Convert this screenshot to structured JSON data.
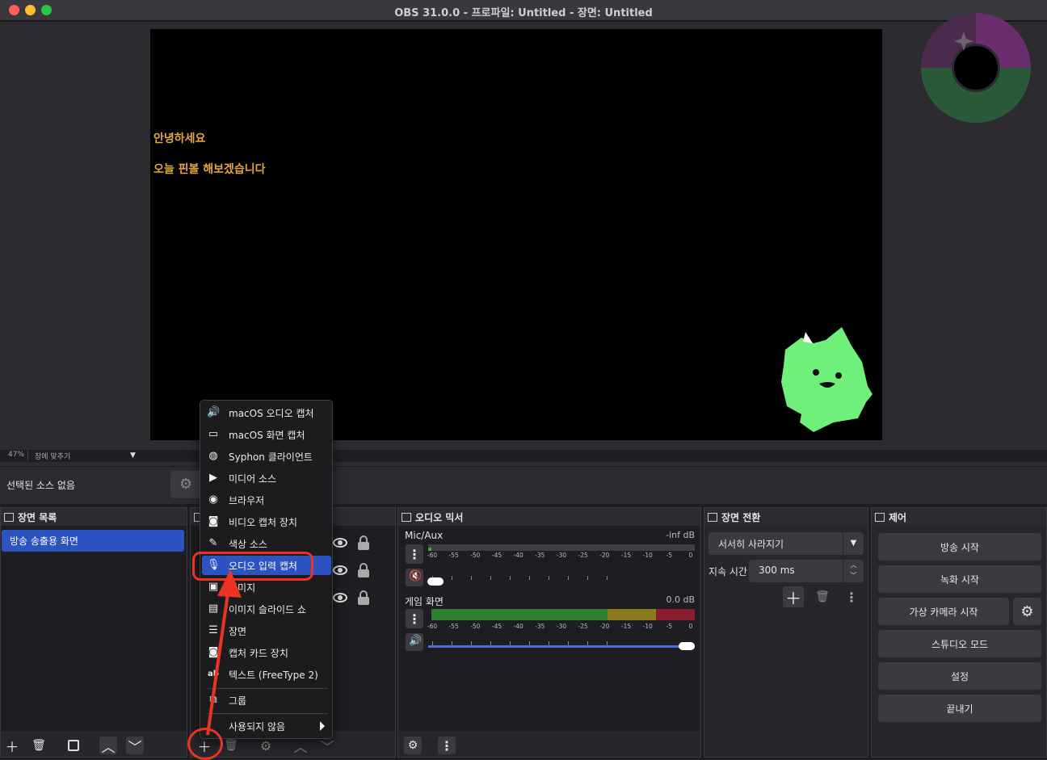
{
  "window": {
    "title": "OBS 31.0.0 - 프로파일: Untitled - 장면: Untitled"
  },
  "preview": {
    "line1": "안녕하세요",
    "line2": "오늘 핀볼 해보겠습니다",
    "zoom": "47%",
    "fit_label": "창에 맞추기"
  },
  "source_bar": {
    "no_source": "선택된 소스 없음"
  },
  "scenes": {
    "title": "장면 목록",
    "items": [
      "방송 송출용 화면"
    ]
  },
  "context_menu": {
    "items": [
      {
        "label": "macOS 오디오 캡처",
        "icon": "speaker-icon"
      },
      {
        "label": "macOS 화면 캡처",
        "icon": "monitor-icon"
      },
      {
        "label": "Syphon 클라이언트",
        "icon": "gamepad-icon"
      },
      {
        "label": "미디어 소스",
        "icon": "play-icon"
      },
      {
        "label": "브라우저",
        "icon": "globe-icon"
      },
      {
        "label": "비디오 캡처 장치",
        "icon": "camera-icon"
      },
      {
        "label": "색상 소스",
        "icon": "brush-icon"
      },
      {
        "label": "오디오 입력 캡처",
        "icon": "microphone-icon"
      },
      {
        "label": "이미지",
        "icon": "image-icon"
      },
      {
        "label": "이미지 슬라이드 쇼",
        "icon": "slideshow-icon"
      },
      {
        "label": "장면",
        "icon": "list-icon"
      },
      {
        "label": "캡처 카드 장치",
        "icon": "camera-icon"
      },
      {
        "label": "텍스트 (FreeType 2)",
        "icon": "text-icon"
      },
      {
        "label": "그룹",
        "icon": "group-icon"
      },
      {
        "label": "사용되지 않음",
        "icon": ""
      }
    ],
    "selected": "오디오 입력 캡처"
  },
  "mixer": {
    "title": "오디오 믹서",
    "channels": [
      {
        "name": "Mic/Aux",
        "db": "-inf dB",
        "muted": true,
        "volume": 0.0
      },
      {
        "name": "게임 화면",
        "db": "0.0 dB",
        "muted": false,
        "volume": 1.0
      }
    ],
    "scale": [
      "-60",
      "-55",
      "-50",
      "-45",
      "-40",
      "-35",
      "-30",
      "-25",
      "-20",
      "-15",
      "-10",
      "-5",
      "0"
    ]
  },
  "transitions": {
    "title": "장면 전환",
    "type": "서서히 사라지기",
    "duration_label": "지속 시간",
    "duration": "300 ms"
  },
  "controls": {
    "title": "제어",
    "start_stream": "방송 시작",
    "start_record": "녹화 시작",
    "virtual_cam": "가상 카메라 시작",
    "studio_mode": "스튜디오 모드",
    "settings": "설정",
    "exit": "끝내기"
  },
  "colors": {
    "accent": "#2d52c2",
    "annotation": "#ea3323",
    "preview_text": "#e8a640",
    "mascot": "#6ef07a"
  }
}
